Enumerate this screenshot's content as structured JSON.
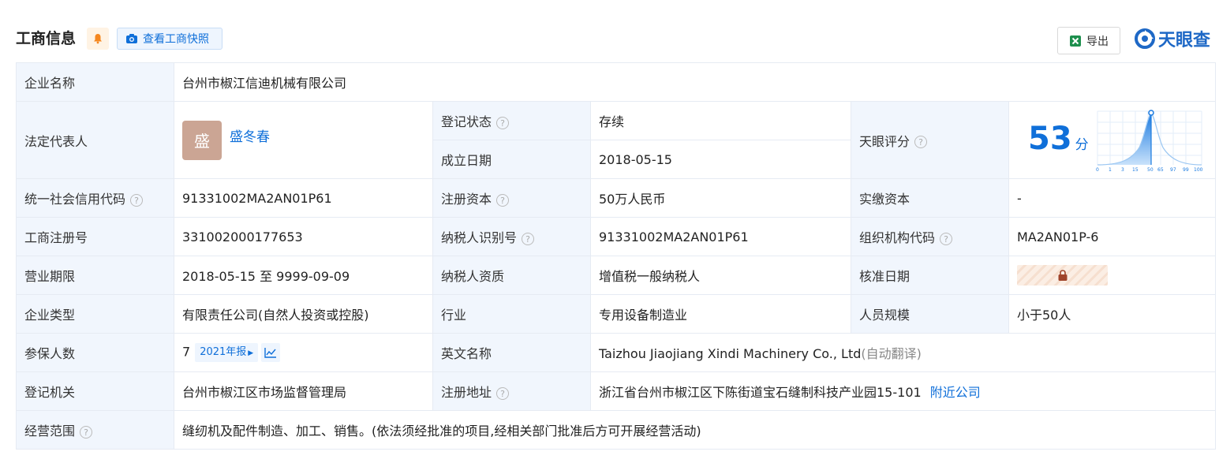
{
  "header": {
    "title": "工商信息",
    "snapshot_label": "查看工商快照",
    "export_label": "导出",
    "brand": "天眼查"
  },
  "info": {
    "company_name_label": "企业名称",
    "company_name": "台州市椒江信迪机械有限公司",
    "legal_rep_label": "法定代表人",
    "legal_rep_avatar": "盛",
    "legal_rep_name": "盛冬春",
    "reg_status_label": "登记状态",
    "reg_status": "存续",
    "founded_label": "成立日期",
    "founded": "2018-05-15",
    "score_label": "天眼评分",
    "score": "53",
    "score_unit": "分",
    "score_axis": [
      "0",
      "1",
      "3",
      "15",
      "50",
      "65",
      "97",
      "99",
      "100"
    ],
    "credit_code_label": "统一社会信用代码",
    "credit_code": "91331002MA2AN01P61",
    "reg_capital_label": "注册资本",
    "reg_capital": "50万人民币",
    "paid_capital_label": "实缴资本",
    "paid_capital": "-",
    "reg_no_label": "工商注册号",
    "reg_no": "331002000177653",
    "taxpayer_id_label": "纳税人识别号",
    "taxpayer_id": "91331002MA2AN01P61",
    "org_code_label": "组织机构代码",
    "org_code": "MA2AN01P-6",
    "term_label": "营业期限",
    "term": "2018-05-15 至 9999-09-09",
    "tax_qual_label": "纳税人资质",
    "tax_qual": "增值税一般纳税人",
    "approve_date_label": "核准日期",
    "type_label": "企业类型",
    "type": "有限责任公司(自然人投资或控股)",
    "industry_label": "行业",
    "industry": "专用设备制造业",
    "staff_label": "人员规模",
    "staff": "小于50人",
    "insured_label": "参保人数",
    "insured": "7",
    "insured_report": "2021年报",
    "en_name_label": "英文名称",
    "en_name": "Taizhou Jiaojiang Xindi Machinery Co., Ltd",
    "en_name_note": "(自动翻译)",
    "authority_label": "登记机关",
    "authority": "台州市椒江区市场监督管理局",
    "address_label": "注册地址",
    "address": "浙江省台州市椒江区下陈街道宝石缝制科技产业园15-101",
    "nearby_label": "附近公司",
    "scope_label": "经营范围",
    "scope": "缝纫机及配件制造、加工、销售。(依法须经批准的项目,经相关部门批准后方可开展经营活动)"
  }
}
